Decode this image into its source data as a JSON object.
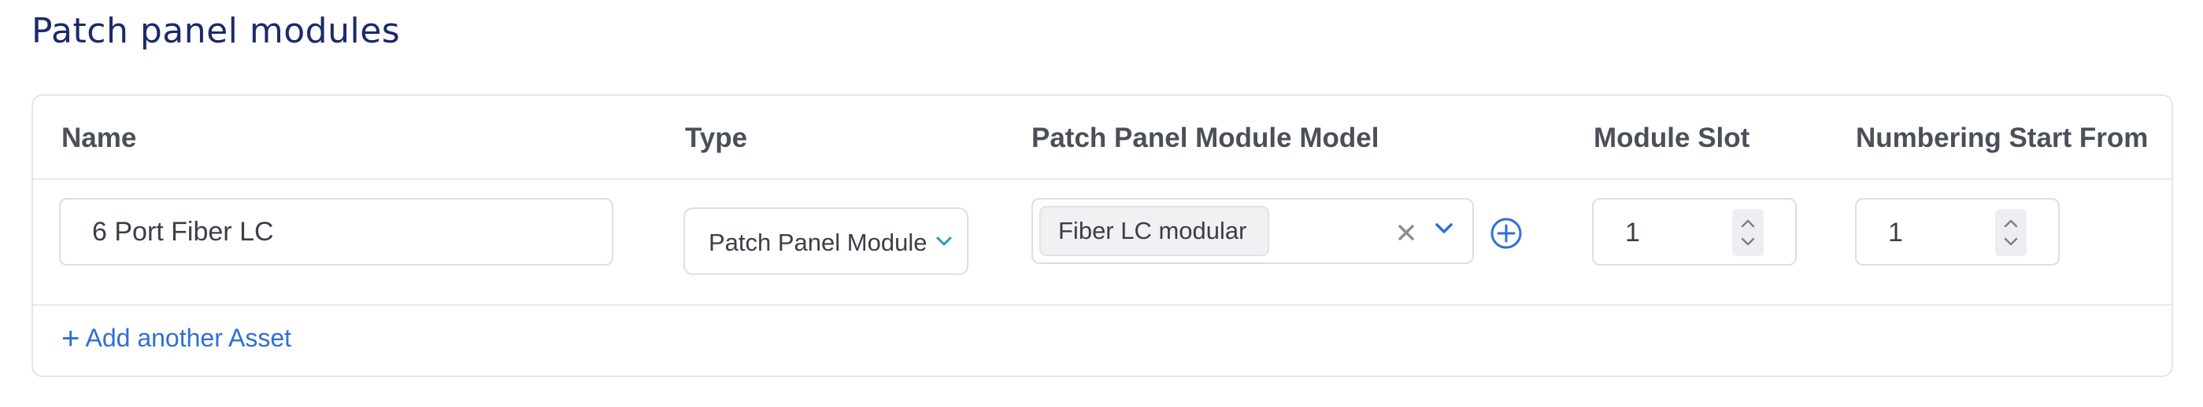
{
  "section": {
    "title": "Patch panel modules"
  },
  "table": {
    "headers": {
      "name": "Name",
      "type": "Type",
      "model": "Patch Panel Module Model",
      "slot": "Module Slot",
      "numbering": "Numbering Start From"
    },
    "row": {
      "name_value": "6 Port Fiber LC",
      "type_value": "Patch Panel Module",
      "model_value": "Fiber LC modular",
      "slot_value": "1",
      "numbering_value": "1"
    },
    "add_link": {
      "plus": "+",
      "label": "Add another Asset"
    }
  },
  "icons": {
    "type_chevron": "chevron-down-icon",
    "model_clear": "close-icon",
    "model_chevron": "chevron-down-icon",
    "add_model": "plus-circle-icon",
    "stepper": "up-down-stepper-icon"
  },
  "colors": {
    "title": "#1b2a6b",
    "link": "#2f6fd6",
    "chevron_teal": "#2a9bb5",
    "chevron_blue": "#2f6fd6",
    "border": "#dcdfe3"
  }
}
